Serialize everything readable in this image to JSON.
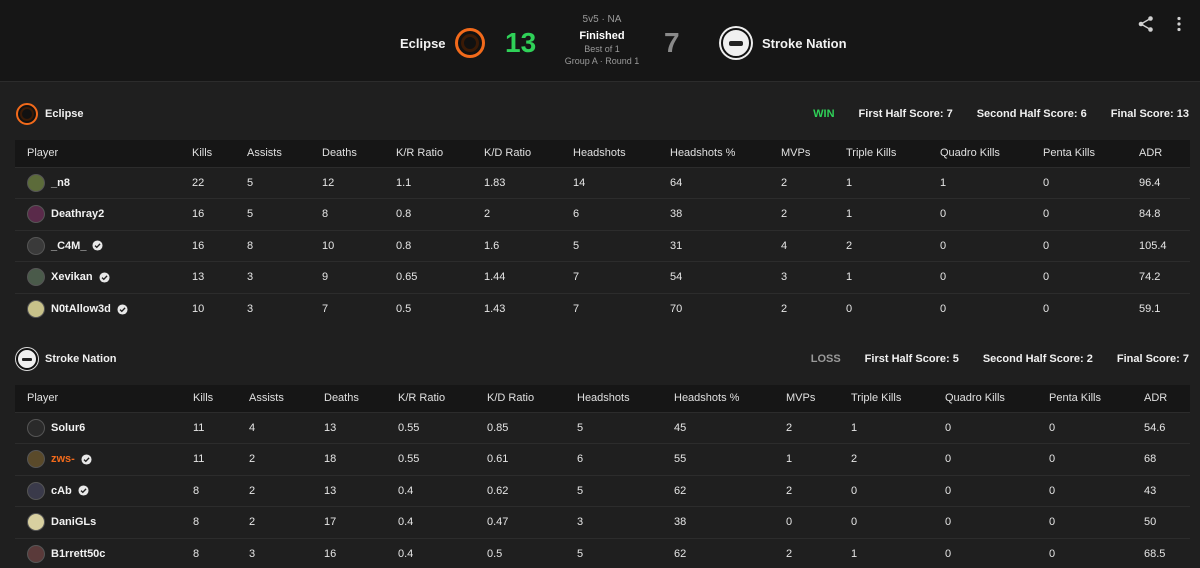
{
  "header": {
    "format": "5v5 · NA",
    "status": "Finished",
    "best_of": "Best of 1",
    "stage": "Group A · Round 1",
    "team_a": {
      "name": "Eclipse",
      "score": "13",
      "color": "#2fd158"
    },
    "team_b": {
      "name": "Stroke Nation",
      "score": "7",
      "color": "#8a8a8a"
    }
  },
  "icons": {
    "share": "share-icon",
    "more": "more-vertical-icon",
    "verified": "verified-badge-icon"
  },
  "columns": [
    "Player",
    "Kills",
    "Assists",
    "Deaths",
    "K/R Ratio",
    "K/D Ratio",
    "Headshots",
    "Headshots %",
    "MVPs",
    "Triple Kills",
    "Quadro Kills",
    "Penta Kills",
    "ADR"
  ],
  "teams": [
    {
      "name": "Eclipse",
      "result": "WIN",
      "first_half": "First Half Score: 7",
      "second_half": "Second Half Score: 6",
      "final": "Final Score: 13",
      "players": [
        {
          "name": "_n8",
          "verified": false,
          "avatar_color": "#5c6b3a",
          "stats": [
            "22",
            "5",
            "12",
            "1.1",
            "1.83",
            "14",
            "64",
            "2",
            "1",
            "1",
            "0",
            "96.4"
          ]
        },
        {
          "name": "Deathray2",
          "verified": false,
          "avatar_color": "#5a2a4a",
          "stats": [
            "16",
            "5",
            "8",
            "0.8",
            "2",
            "6",
            "38",
            "2",
            "1",
            "0",
            "0",
            "84.8"
          ]
        },
        {
          "name": "_C4M_",
          "verified": true,
          "avatar_color": "#3a3a3a",
          "stats": [
            "16",
            "8",
            "10",
            "0.8",
            "1.6",
            "5",
            "31",
            "4",
            "2",
            "0",
            "0",
            "105.4"
          ]
        },
        {
          "name": "Xevikan",
          "verified": true,
          "avatar_color": "#4a5a4a",
          "stats": [
            "13",
            "3",
            "9",
            "0.65",
            "1.44",
            "7",
            "54",
            "3",
            "1",
            "0",
            "0",
            "74.2"
          ]
        },
        {
          "name": "N0tAllow3d",
          "verified": true,
          "avatar_color": "#c8c28a",
          "stats": [
            "10",
            "3",
            "7",
            "0.5",
            "1.43",
            "7",
            "70",
            "2",
            "0",
            "0",
            "0",
            "59.1"
          ]
        }
      ]
    },
    {
      "name": "Stroke Nation",
      "result": "LOSS",
      "first_half": "First Half Score: 5",
      "second_half": "Second Half Score: 2",
      "final": "Final Score: 7",
      "players": [
        {
          "name": "Solur6",
          "verified": false,
          "avatar_color": "#2a2a2a",
          "stats": [
            "11",
            "4",
            "13",
            "0.55",
            "0.85",
            "5",
            "45",
            "2",
            "1",
            "0",
            "0",
            "54.6"
          ]
        },
        {
          "name": "zws-",
          "verified": true,
          "avatar_color": "#5a4a2a",
          "name_color": "orange",
          "stats": [
            "11",
            "2",
            "18",
            "0.55",
            "0.61",
            "6",
            "55",
            "1",
            "2",
            "0",
            "0",
            "68"
          ]
        },
        {
          "name": "cAb",
          "verified": true,
          "avatar_color": "#3a3a4a",
          "stats": [
            "8",
            "2",
            "13",
            "0.4",
            "0.62",
            "5",
            "62",
            "2",
            "0",
            "0",
            "0",
            "43"
          ]
        },
        {
          "name": "DaniGLs",
          "verified": false,
          "avatar_color": "#d8d0a0",
          "stats": [
            "8",
            "2",
            "17",
            "0.4",
            "0.47",
            "3",
            "38",
            "0",
            "0",
            "0",
            "0",
            "50"
          ]
        },
        {
          "name": "B1rrett50c",
          "verified": false,
          "avatar_color": "#5a3a3a",
          "stats": [
            "8",
            "3",
            "16",
            "0.4",
            "0.5",
            "5",
            "62",
            "2",
            "1",
            "0",
            "0",
            "68.5"
          ]
        }
      ]
    }
  ]
}
